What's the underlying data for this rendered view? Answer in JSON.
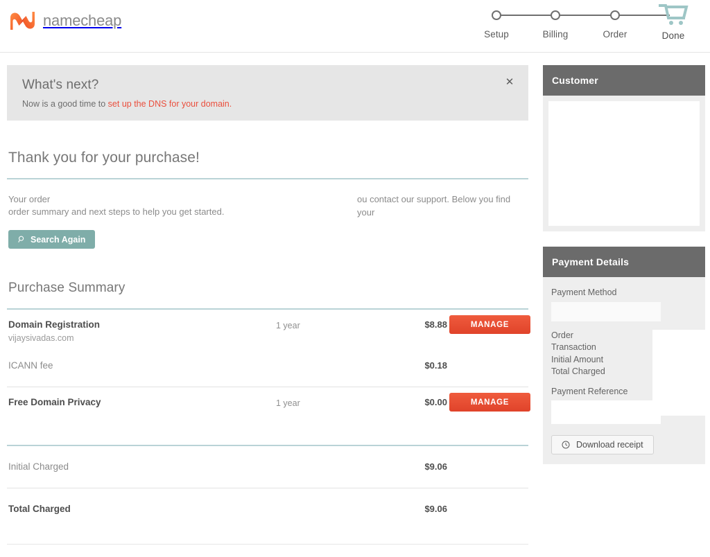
{
  "header": {
    "brand_name": "namecheap",
    "brand_icon": "namecheap-logo",
    "steps": [
      {
        "label": "Setup",
        "icon": "step-dot"
      },
      {
        "label": "Billing",
        "icon": "step-dot"
      },
      {
        "label": "Order",
        "icon": "step-dot"
      },
      {
        "label": "Done",
        "icon": "shopping-cart-icon"
      }
    ]
  },
  "notice": {
    "title": "What's next?",
    "text_prefix": "Now is a good time to ",
    "link_text": "set up the DNS for your domain.",
    "close_icon": "✕"
  },
  "thanks": {
    "title": "Thank you for your purchase!",
    "intro_a": "Your order",
    "intro_b": "ou contact our support. Below you find your",
    "intro_c": "order summary and next steps to help you get started.",
    "search_button": "Search Again",
    "search_icon": "search-icon"
  },
  "summary": {
    "title": "Purchase Summary",
    "items": [
      {
        "name": "Domain Registration",
        "sub": "vijaysivadas.com",
        "term": "1 year",
        "price": "$8.88",
        "action": "MANAGE"
      },
      {
        "name": "Free Domain Privacy",
        "sub": "",
        "term": "1 year",
        "price": "$0.00",
        "action": "MANAGE"
      }
    ],
    "fee": {
      "name": "ICANN fee",
      "price": "$0.18"
    },
    "totals": [
      {
        "label": "Initial Charged",
        "value": "$9.06"
      },
      {
        "label": "Total Charged",
        "value": "$9.06"
      }
    ]
  },
  "customer_panel": {
    "title": "Customer"
  },
  "payment_panel": {
    "title": "Payment Details",
    "method_label": "Payment Method",
    "fields": [
      "Order",
      "Transaction",
      "Initial Amount",
      "Total Charged"
    ],
    "reference_label": "Payment Reference",
    "download_button": "Download receipt",
    "download_icon": "clock-download-icon"
  },
  "colors": {
    "brand_orange": "#f26522",
    "accent_red": "#ea4f3d",
    "teal_rule": "#b9d3d6",
    "teal_button": "#7fada9",
    "panel_header": "#6b6b6b",
    "notice_bg": "#e6e6e6"
  }
}
